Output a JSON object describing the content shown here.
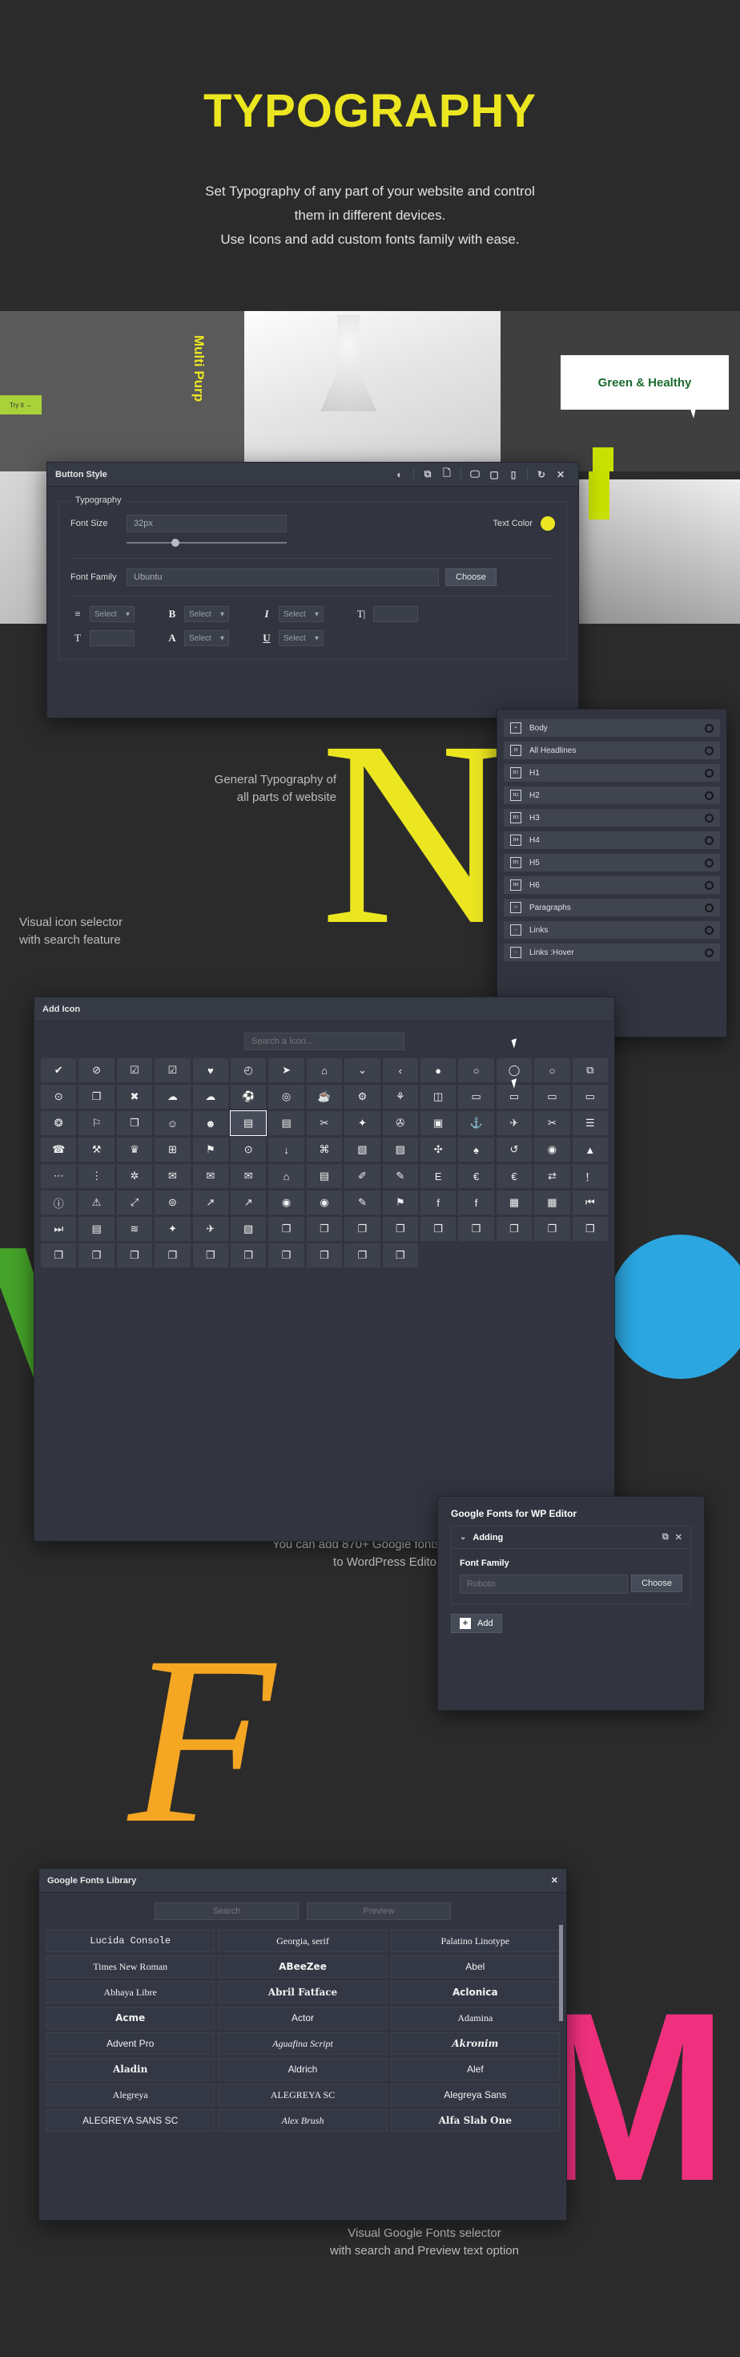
{
  "hero": {
    "title": "TYPOGRAPHY",
    "subtitle_line1": "Set Typography of any part of your website and control",
    "subtitle_line2": "them in different devices.",
    "subtitle_line3": "Use Icons and add custom fonts family with ease.",
    "accent_color": "#ece621"
  },
  "band": {
    "try_button": "Try it →",
    "multi_purpose": "Multi Purp",
    "green_healthy": "Green & Healthy"
  },
  "captions": {
    "general": "General Typography of\nall parts of website",
    "icon": "Visual icon selector\nwith search feature",
    "gfonts": "You can add 870+ Google fonts\nto WordPress Editor",
    "visual": "Visual Google Fonts selector\nwith search and Preview text option"
  },
  "button_style": {
    "title": "Button Style",
    "header_icons": [
      "contrast-icon",
      "copy-icon",
      "paste-icon",
      "desktop-icon",
      "tablet-icon",
      "mobile-icon",
      "reset-icon",
      "close-icon"
    ],
    "legend": "Typography",
    "font_size_label": "Font Size",
    "font_size_value": "32px",
    "text_color_label": "Text Color",
    "text_color_value": "#ece621",
    "font_family_label": "Font Family",
    "font_family_value": "Ubuntu",
    "choose_label": "Choose",
    "controls_row1": [
      {
        "icon": "text-align-icon",
        "glyph": "≡",
        "value": "Select"
      },
      {
        "icon": "bold-icon",
        "glyph": "B",
        "value": "Select"
      },
      {
        "icon": "italic-icon",
        "glyph": "I",
        "value": "Select"
      },
      {
        "icon": "line-height-icon",
        "glyph": "T↕",
        "value": ""
      }
    ],
    "controls_row2": [
      {
        "icon": "letter-spacing-icon",
        "glyph": "T",
        "value": ""
      },
      {
        "icon": "text-transform-icon",
        "glyph": "A",
        "value": "Select"
      },
      {
        "icon": "underline-icon",
        "glyph": "U",
        "value": "Select"
      }
    ]
  },
  "typography_targets": {
    "items": [
      {
        "badge": "≡",
        "label": "Body",
        "icon": "body-icon"
      },
      {
        "badge": "H",
        "label": "All Headlines",
        "icon": "headline-icon"
      },
      {
        "badge": "H1",
        "label": "H1",
        "icon": "h1-icon"
      },
      {
        "badge": "H2",
        "label": "H2",
        "icon": "h2-icon"
      },
      {
        "badge": "H3",
        "label": "H3",
        "icon": "h3-icon"
      },
      {
        "badge": "H4",
        "label": "H4",
        "icon": "h4-icon"
      },
      {
        "badge": "H5",
        "label": "H5",
        "icon": "h5-icon"
      },
      {
        "badge": "H6",
        "label": "H6",
        "icon": "h6-icon"
      },
      {
        "badge": "≡",
        "label": "Paragraphs",
        "icon": "paragraph-icon"
      },
      {
        "badge": "–",
        "label": "Links",
        "icon": "link-icon"
      },
      {
        "badge": "–",
        "label": "Links :Hover",
        "icon": "link-hover-icon"
      }
    ]
  },
  "add_icon": {
    "title": "Add Icon",
    "search_placeholder": "Search a Icon...",
    "selected_index": 35,
    "glyphs": [
      "✔",
      "⊘",
      "☑",
      "☑",
      "♥",
      "◴",
      "➤",
      "⌂",
      "⌄",
      "‹",
      "●",
      "○",
      "◯",
      "○",
      "⧉",
      "⊙",
      "❐",
      "✖",
      "☁",
      "☁",
      "⚽",
      "◎",
      "☕",
      "⚙",
      "⚘",
      "◫",
      "▭",
      "▭",
      "▭",
      "▭",
      "❂",
      "⚐",
      "❐",
      "☺",
      "☻",
      "▤",
      "▤",
      "✂",
      "✦",
      "✇",
      "▣",
      "⚓",
      "✈",
      "✂",
      "☰",
      "☎",
      "⚒",
      "♛",
      "⊞",
      "⚑",
      "⊙",
      "↓",
      "⌘",
      "▧",
      "▨",
      "✣",
      "♠",
      "↺",
      "◉",
      "▲",
      "⋯",
      "⋮",
      "✲",
      "✉",
      "✉",
      "✉",
      "⌂",
      "▤",
      "✐",
      "✎",
      "E",
      "€",
      "€",
      "⇄",
      "！",
      "ⓘ",
      "⚠",
      "⤢",
      "⊜",
      "↗",
      "↗",
      "◉",
      "◉",
      "✎",
      "⚑",
      "f",
      "f",
      "▦",
      "▦",
      "⏮",
      "⏭",
      "▤",
      "≋",
      "✦",
      "✈",
      "▧",
      "❐",
      "❐",
      "❐",
      "❐",
      "❐",
      "❐",
      "❐",
      "❐",
      "❐",
      "❐",
      "❐",
      "❐",
      "❐",
      "❐",
      "❐",
      "❐",
      "❐",
      "❐",
      "❐"
    ]
  },
  "gfonts_wp": {
    "title": "Google Fonts for WP Editor",
    "section_label": "Adding",
    "font_family_label": "Font Family",
    "font_family_placeholder": "Roboto",
    "choose_label": "Choose",
    "add_label": "Add",
    "duplicate_icon": "duplicate-icon",
    "close_icon": "close-icon"
  },
  "gfonts_library": {
    "title": "Google Fonts Library",
    "search_placeholder": "Search",
    "preview_placeholder": "Preview",
    "close_icon": "close-icon",
    "fonts": [
      {
        "name": "Lucida Console",
        "style": "font-family:'Liberation Mono',monospace;"
      },
      {
        "name": "Georgia, serif",
        "style": "font-family:'Liberation Serif',serif;"
      },
      {
        "name": "Palatino Linotype",
        "style": "font-family:'Liberation Serif',serif;"
      },
      {
        "name": "Times New Roman",
        "style": "font-family:'Liberation Serif',serif;"
      },
      {
        "name": "ABeeZee",
        "style": "font-family:'DejaVu Sans',sans-serif;font-weight:bold;"
      },
      {
        "name": "Abel",
        "style": "font-family:'Liberation Sans',sans-serif;"
      },
      {
        "name": "Abhaya Libre",
        "style": "font-family:'Liberation Serif',serif;"
      },
      {
        "name": "Abril Fatface",
        "style": "font-family:'DejaVu Serif',serif;font-weight:bold;"
      },
      {
        "name": "Aclonica",
        "style": "font-family:'DejaVu Sans',sans-serif;font-weight:bold;"
      },
      {
        "name": "Acme",
        "style": "font-family:'DejaVu Sans',sans-serif;font-weight:bold;"
      },
      {
        "name": "Actor",
        "style": "font-family:'Liberation Sans',sans-serif;"
      },
      {
        "name": "Adamina",
        "style": "font-family:'Liberation Serif',serif;"
      },
      {
        "name": "Advent Pro",
        "style": "font-family:'Liberation Sans',sans-serif;"
      },
      {
        "name": "Aguafina Script",
        "style": "font-family:'Liberation Serif',serif;font-style:italic;"
      },
      {
        "name": "Akronim",
        "style": "font-family:'DejaVu Serif',serif;font-style:italic;font-weight:bold;"
      },
      {
        "name": "Aladin",
        "style": "font-family:'DejaVu Serif',serif;font-weight:bold;"
      },
      {
        "name": "Aldrich",
        "style": "font-family:'Liberation Sans',sans-serif;"
      },
      {
        "name": "Alef",
        "style": "font-family:'Liberation Sans',sans-serif;"
      },
      {
        "name": "Alegreya",
        "style": "font-family:'Liberation Serif',serif;"
      },
      {
        "name": "ALEGREYA SC",
        "style": "font-family:'Liberation Serif',serif;font-variant:small-caps;"
      },
      {
        "name": "Alegreya Sans",
        "style": "font-family:'Liberation Sans',sans-serif;"
      },
      {
        "name": "ALEGREYA SANS SC",
        "style": "font-family:'Liberation Sans',sans-serif;font-variant:small-caps;"
      },
      {
        "name": "Alex Brush",
        "style": "font-family:'Liberation Serif',serif;font-style:italic;"
      },
      {
        "name": "Alfa Slab One",
        "style": "font-family:'DejaVu Serif',serif;font-weight:bold;"
      }
    ]
  }
}
